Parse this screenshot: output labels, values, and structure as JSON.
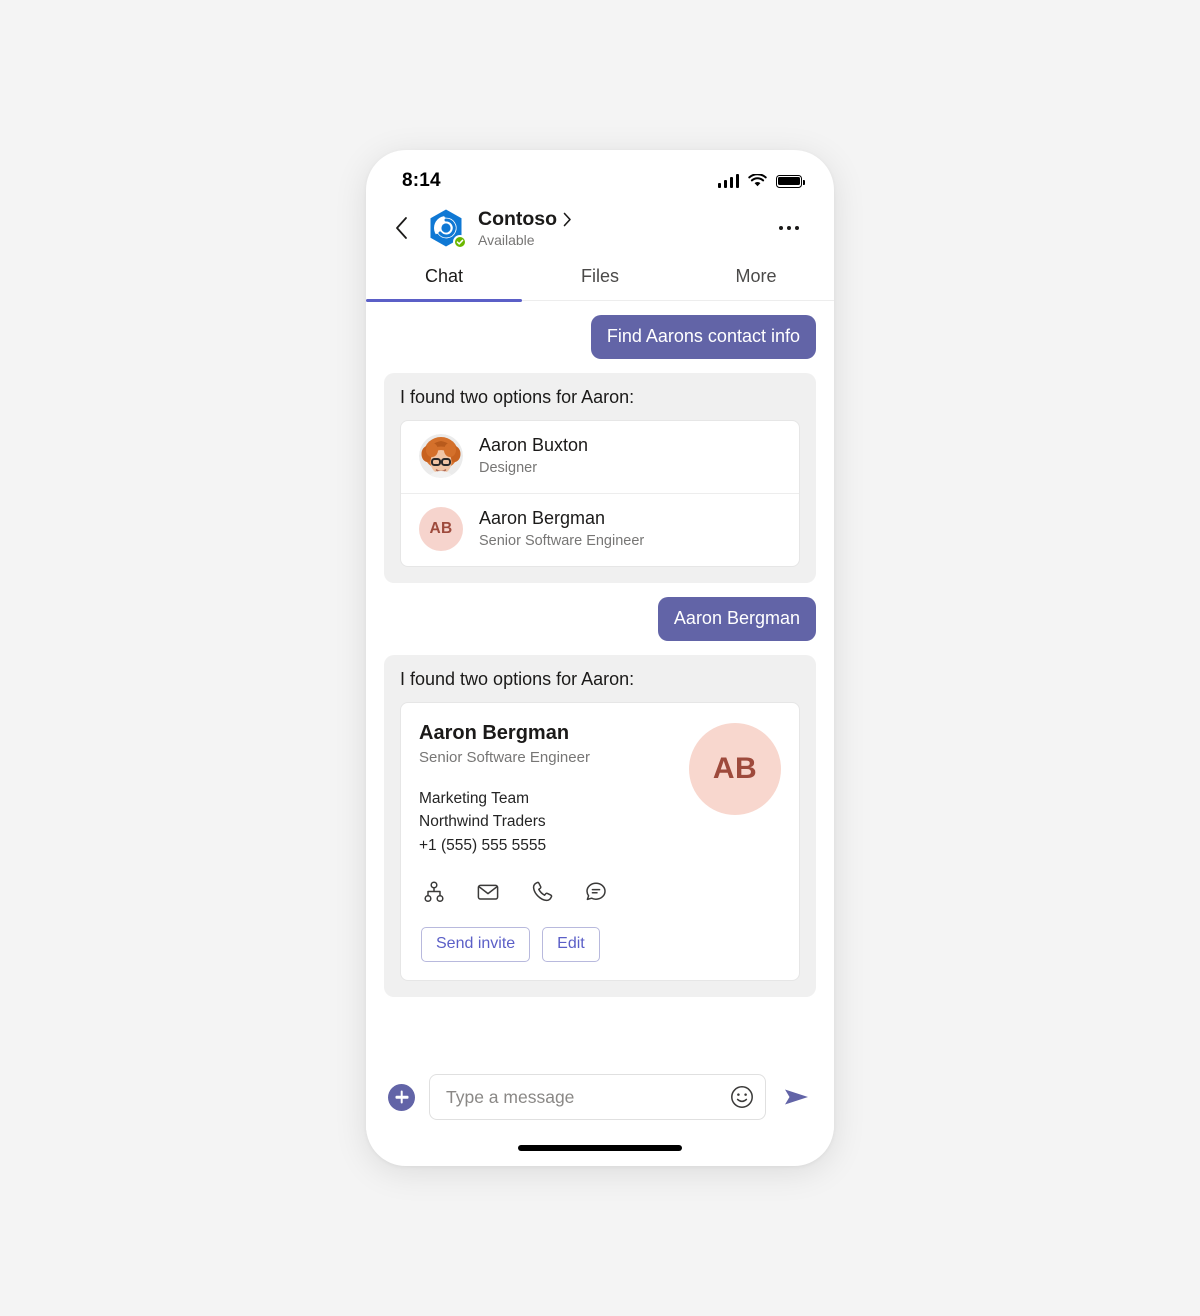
{
  "colors": {
    "accent": "#6264a7",
    "accent_tab": "#5b5fc7",
    "available": "#6bb700",
    "avatar_bg": "#f6d4cd",
    "avatar_fg": "#9e4a3c",
    "page_bg": "#f4f4f4",
    "card_bg": "#f0f0f0"
  },
  "statusbar": {
    "time": "8:14",
    "signal_icon": "cellular-signal-icon",
    "wifi_icon": "wifi-icon",
    "battery_icon": "battery-full-icon"
  },
  "header": {
    "back_icon": "chevron-left-icon",
    "logo_icon": "contoso-logo-icon",
    "presence_icon": "available-check-icon",
    "title": "Contoso",
    "title_chevron_icon": "chevron-right-icon",
    "subtitle": "Available",
    "more_icon": "more-options-icon"
  },
  "tabs": [
    {
      "label": "Chat",
      "active": true
    },
    {
      "label": "Files",
      "active": false
    },
    {
      "label": "More",
      "active": false
    }
  ],
  "messages": [
    {
      "type": "outgoing",
      "text": "Find Aarons contact info"
    },
    {
      "type": "card_list",
      "title": "I found two options for Aaron:",
      "people": [
        {
          "name": "Aaron Buxton",
          "role": "Designer",
          "avatar_type": "photo",
          "avatar_icon": "user-photo-avatar"
        },
        {
          "name": "Aaron Bergman",
          "role": "Senior Software Engineer",
          "avatar_type": "initials",
          "initials": "AB"
        }
      ]
    },
    {
      "type": "outgoing",
      "text": "Aaron Bergman"
    },
    {
      "type": "card_detail",
      "title": "I found two options for Aaron:",
      "contact": {
        "name": "Aaron Bergman",
        "role": "Senior Software Engineer",
        "initials": "AB",
        "team": "Marketing Team",
        "company": "Northwind Traders",
        "phone": "+1 (555) 555 5555",
        "actions": [
          {
            "icon": "org-chart-icon",
            "name": "org-chart"
          },
          {
            "icon": "envelope-icon",
            "name": "email"
          },
          {
            "icon": "phone-icon",
            "name": "call"
          },
          {
            "icon": "chat-bubble-icon",
            "name": "chat"
          }
        ],
        "buttons": [
          {
            "label": "Send invite"
          },
          {
            "label": "Edit"
          }
        ]
      }
    }
  ],
  "composer": {
    "add_icon": "plus-icon",
    "placeholder": "Type a message",
    "emoji_icon": "emoji-smiley-icon",
    "send_icon": "send-arrow-icon"
  },
  "home_indicator": "home-indicator-bar"
}
